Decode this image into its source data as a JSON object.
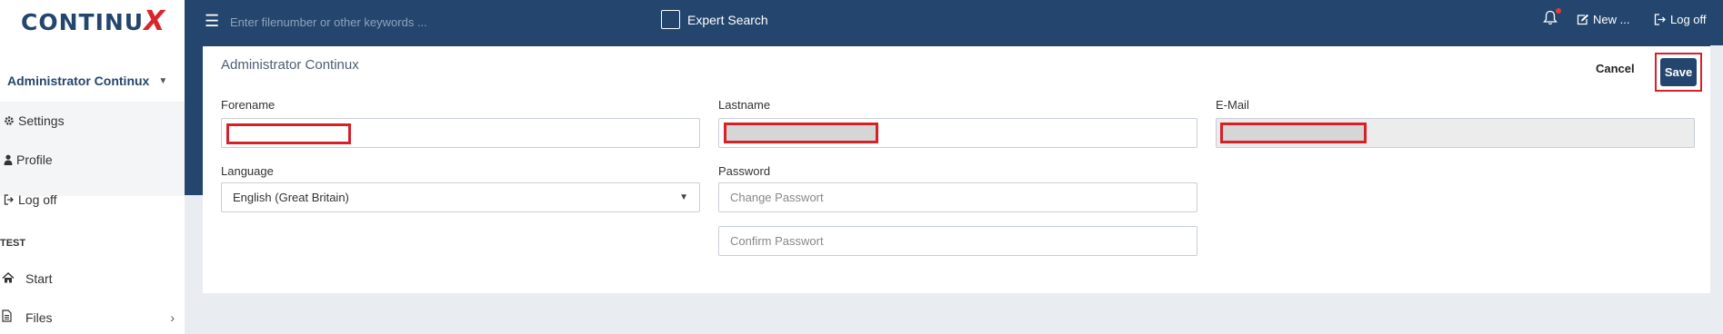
{
  "logo": {
    "text_main": "CONTINU",
    "text_x": "X"
  },
  "user": {
    "name": "Administrator Continux"
  },
  "user_menu": [
    {
      "label": "Settings",
      "icon": "gear-icon"
    },
    {
      "label": "Profile",
      "icon": "user-icon"
    },
    {
      "label": "Log off",
      "icon": "sign-out-icon"
    }
  ],
  "section": {
    "label": "TEST"
  },
  "nav": [
    {
      "label": "Start",
      "icon": "home-icon"
    },
    {
      "label": "Files",
      "icon": "file-icon",
      "chevron": "›"
    }
  ],
  "topbar": {
    "search_placeholder": "Enter filenumber or other keywords ...",
    "expert_label": "Expert Search",
    "new_label": "New ...",
    "logoff_label": "Log off"
  },
  "card": {
    "title": "Administrator Continux",
    "cancel_label": "Cancel",
    "save_label": "Save",
    "forename_label": "Forename",
    "lastname_label": "Lastname",
    "email_label": "E-Mail",
    "language_label": "Language",
    "language_value": "English (Great Britain)",
    "password_label": "Password",
    "password_placeholder": "Change Passwort",
    "confirm_placeholder": "Confirm Passwort"
  },
  "colors": {
    "brand": "#24466e",
    "accent_red": "#d62127",
    "logo_x": "#d9262b"
  }
}
